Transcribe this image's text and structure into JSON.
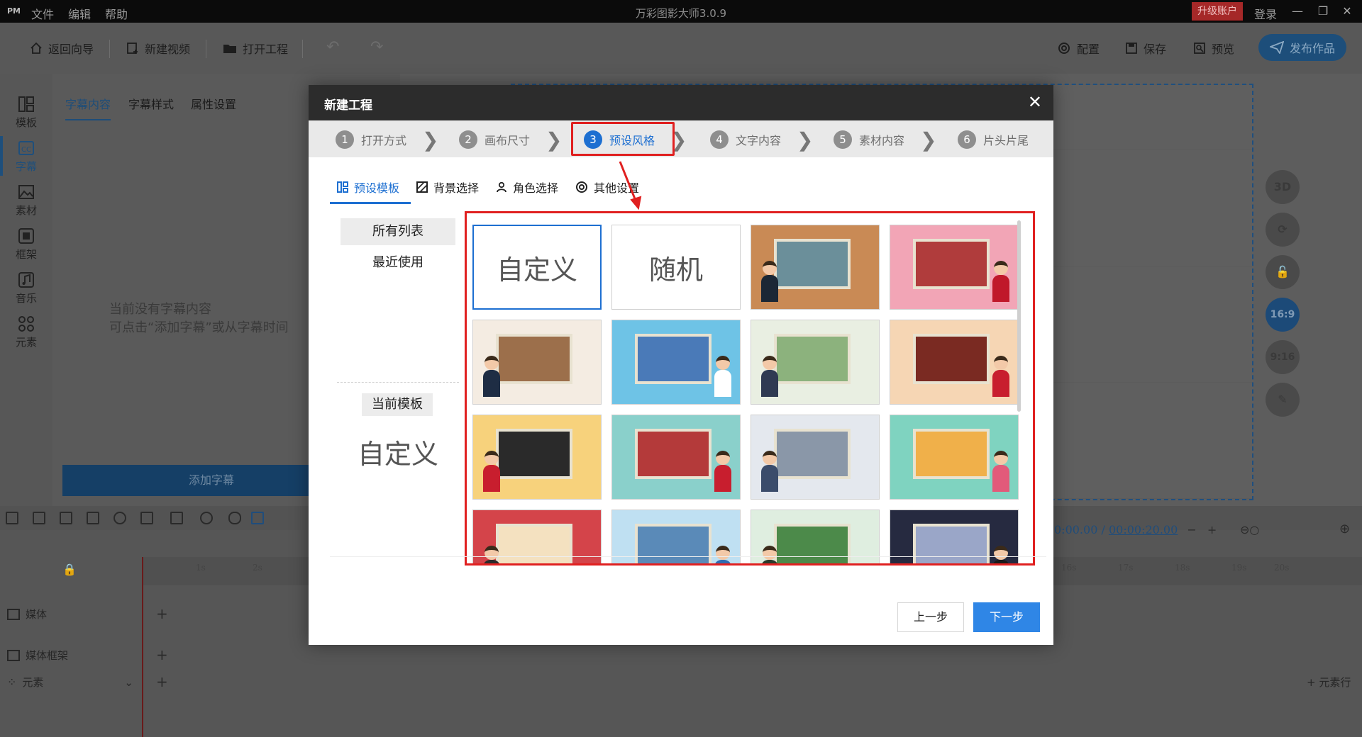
{
  "titlebar": {
    "logo": "PM",
    "menus": [
      "文件",
      "编辑",
      "帮助"
    ],
    "title": "万彩图影大师3.0.9",
    "upgrade": "升级账户",
    "login": "登录"
  },
  "toolbar": {
    "back": "返回向导",
    "new_video": "新建视频",
    "open_project": "打开工程",
    "config": "配置",
    "save": "保存",
    "preview": "预览",
    "publish": "发布作品"
  },
  "sidebar": {
    "items": [
      {
        "label": "模板",
        "icon": "template-icon"
      },
      {
        "label": "字幕",
        "icon": "subtitle-icon"
      },
      {
        "label": "素材",
        "icon": "material-icon"
      },
      {
        "label": "框架",
        "icon": "frame-icon"
      },
      {
        "label": "音乐",
        "icon": "music-icon"
      },
      {
        "label": "元素",
        "icon": "element-icon"
      }
    ],
    "active": "字幕"
  },
  "subpanel": {
    "tabs": [
      "字幕内容",
      "字幕样式",
      "属性设置"
    ],
    "empty_line1": "当前没有字幕内容",
    "empty_line2": "可点击“添加字幕”或从字幕时间",
    "add_button": "添加字幕"
  },
  "right_tools": [
    "3D",
    "16:9",
    "9:16"
  ],
  "timeline": {
    "current_time": "0:00.00",
    "separator": "/",
    "total_time": "00:00:20.00",
    "ticks_left": [
      "1s",
      "2s"
    ],
    "ticks_right": [
      "16s",
      "17s",
      "18s",
      "19s",
      "20s"
    ],
    "tracks": [
      "媒体",
      "媒体框架",
      "元素"
    ],
    "element_row_button": "元素行"
  },
  "modal": {
    "title": "新建工程",
    "steps": [
      {
        "num": "1",
        "label": "打开方式"
      },
      {
        "num": "2",
        "label": "画布尺寸"
      },
      {
        "num": "3",
        "label": "预设风格"
      },
      {
        "num": "4",
        "label": "文字内容"
      },
      {
        "num": "5",
        "label": "素材内容"
      },
      {
        "num": "6",
        "label": "片头片尾"
      }
    ],
    "active_step": "3",
    "subtabs": [
      "预设模板",
      "背景选择",
      "角色选择",
      "其他设置"
    ],
    "categories": [
      "所有列表",
      "最近使用"
    ],
    "current_template_label": "当前模板",
    "current_template_name": "自定义",
    "tiles": [
      {
        "type": "text",
        "label": "自定义"
      },
      {
        "type": "text",
        "label": "随机"
      },
      {
        "type": "image",
        "bg": "#c98a55",
        "accent": "#6b8f9a",
        "figure": "#1b2735"
      },
      {
        "type": "image",
        "bg": "#f2a5b6",
        "accent": "#b03c3c",
        "figure": "#c0182a"
      },
      {
        "type": "image",
        "bg": "#f4ece2",
        "accent": "#9c6f4b",
        "figure": "#1e2d44"
      },
      {
        "type": "image",
        "bg": "#6ec3e6",
        "accent": "#4a7ab8",
        "figure": "#ffffff"
      },
      {
        "type": "image",
        "bg": "#e9efe2",
        "accent": "#8cb27d",
        "figure": "#2f3a52"
      },
      {
        "type": "image",
        "bg": "#f6d6b4",
        "accent": "#7a2a22",
        "figure": "#c81e2e"
      },
      {
        "type": "image",
        "bg": "#f7d27c",
        "accent": "#2a2a2a",
        "figure": "#c81e2e"
      },
      {
        "type": "image",
        "bg": "#8ad0cb",
        "accent": "#b43a3a",
        "figure": "#c81e2e"
      },
      {
        "type": "image",
        "bg": "#e4e8ee",
        "accent": "#8a97a8",
        "figure": "#3b4c6b"
      },
      {
        "type": "image",
        "bg": "#7fd3c0",
        "accent": "#f0b04a",
        "figure": "#e25a7a"
      },
      {
        "type": "image",
        "bg": "#d4444a",
        "accent": "#f4e1c0",
        "figure": "#2b2b2b"
      },
      {
        "type": "image",
        "bg": "#bfe0f2",
        "accent": "#5a8ab8",
        "figure": "#2f6bb0"
      },
      {
        "type": "image",
        "bg": "#dfeee0",
        "accent": "#4c8a4a",
        "figure": "#2a3a2a"
      },
      {
        "type": "image",
        "bg": "#262a40",
        "accent": "#9aa6c8",
        "figure": "#1a1a1a"
      }
    ],
    "prev_button": "上一步",
    "next_button": "下一步"
  }
}
